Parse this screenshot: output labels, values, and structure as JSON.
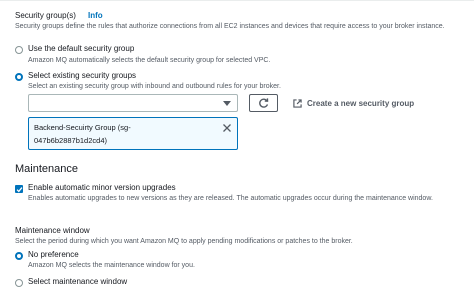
{
  "security_groups": {
    "title": "Security group(s)",
    "info_label": "Info",
    "description": "Security groups define the rules that authorize connections from all EC2 instances and devices that require access to your broker instance.",
    "options": [
      {
        "label": "Use the default security group",
        "description": "Amazon MQ automatically selects the default security group for selected VPC.",
        "selected": false
      },
      {
        "label": "Select existing security groups",
        "description": "Select an existing security group with inbound and outbound rules for your broker.",
        "selected": true
      }
    ],
    "select_value": "",
    "create_link_label": "Create a new security group",
    "selected_token": {
      "line1": "Backend-Secuirty Group (sg-",
      "line2": "047b6b2887b1d2cd4)"
    }
  },
  "maintenance": {
    "title": "Maintenance",
    "auto_upgrade": {
      "label": "Enable automatic minor version upgrades",
      "description": "Enables automatic upgrades to new versions as they are released. The automatic upgrades occur during the maintenance window.",
      "checked": true
    },
    "window": {
      "title": "Maintenance window",
      "description": "Select the period during which you want Amazon MQ to apply pending modifications or patches to the broker.",
      "options": [
        {
          "label": "No preference",
          "description": "Amazon MQ selects the maintenance window for you.",
          "selected": true
        },
        {
          "label": "Select maintenance window",
          "selected": false
        }
      ]
    }
  },
  "colors": {
    "accent": "#0073bb",
    "text": "#16191f",
    "muted": "#545b64"
  },
  "icons": {
    "refresh": "refresh-icon",
    "external": "external-link-icon",
    "dropdown": "caret-down-icon",
    "remove": "close-icon",
    "check": "check-icon"
  }
}
